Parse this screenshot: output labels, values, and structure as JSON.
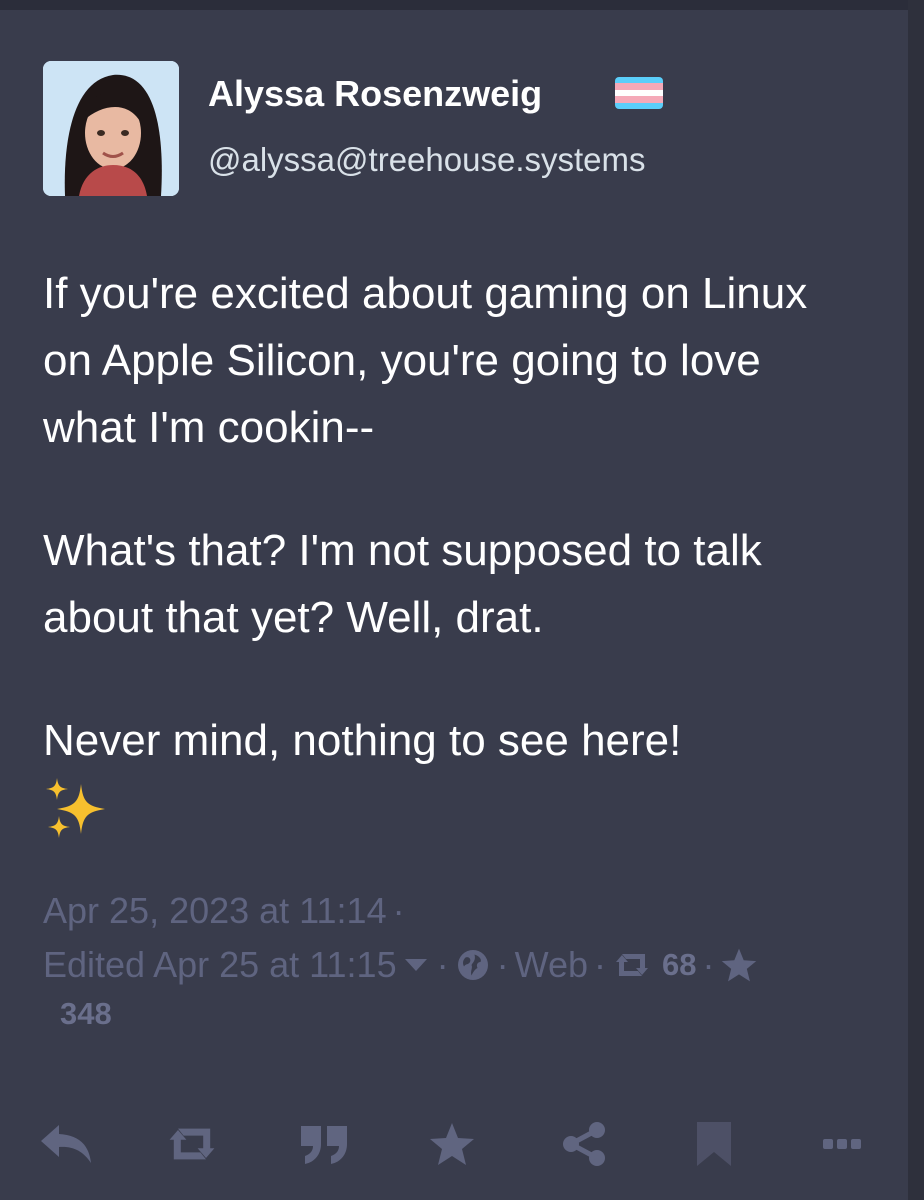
{
  "account": {
    "display_name": "Alyssa Rosenzweig",
    "handle": "@alyssa@treehouse.systems",
    "flag_colors": [
      "#5bcefa",
      "#f5a9b8",
      "#ffffff",
      "#f5a9b8",
      "#5bcefa"
    ]
  },
  "status": {
    "paragraphs": [
      "If you're excited about gaming on Linux on Apple Silicon, you're going to love what I'm cookin--",
      "What's that? I'm not supposed to talk about that yet? Well, drat.",
      "Never mind, nothing to see here!"
    ],
    "emoji": "sparkles-emoji"
  },
  "meta": {
    "posted": "Apr 25, 2023 at 11:14",
    "edited": "Edited Apr 25 at 11:15",
    "visibility_icon": "globe-icon",
    "application": "Web",
    "reblogs": "68",
    "favourites": "348",
    "separator": "·"
  },
  "actions": [
    "reply-icon",
    "boost-icon",
    "quote-icon",
    "favourite-icon",
    "share-icon",
    "bookmark-icon",
    "more-icon"
  ],
  "colors": {
    "background": "#393c4c",
    "text": "#ffffff",
    "muted": "#5f6480",
    "icon": "#606580"
  }
}
